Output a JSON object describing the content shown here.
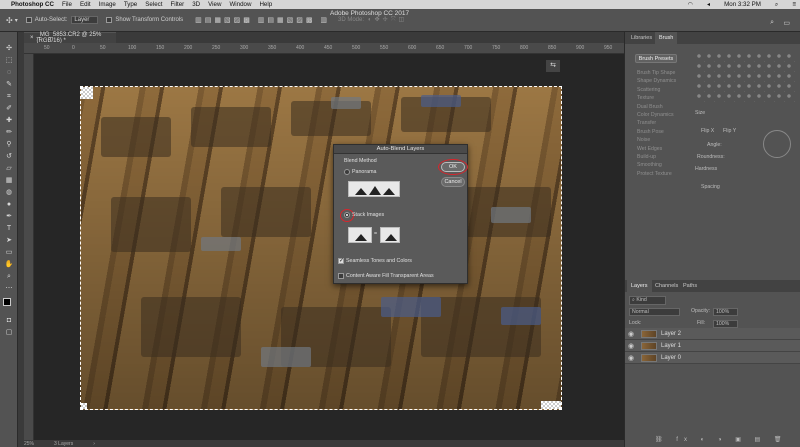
{
  "menubar": {
    "apple": "",
    "app_name": "Photoshop CC",
    "items": [
      "File",
      "Edit",
      "Image",
      "Type",
      "Select",
      "Filter",
      "3D",
      "View",
      "Window",
      "Help"
    ],
    "clock": "Mon 3:32 PM"
  },
  "options_bar": {
    "auto_select_label": "Auto-Select:",
    "auto_select_value": "Layer",
    "transform_controls_label": "Show Transform Controls",
    "mode_3d_label": "3D Mode:",
    "app_title": "Adobe Photoshop CC 2017"
  },
  "document": {
    "tab_label": "_MG_5853.CR2 @ 25% (RGB/16) *",
    "ruler_ticks": [
      "50",
      "0",
      "50",
      "100",
      "150",
      "200",
      "250",
      "300",
      "350",
      "400",
      "450",
      "500",
      "550",
      "600",
      "650",
      "700",
      "750",
      "800",
      "850",
      "900",
      "950"
    ]
  },
  "status_bar": {
    "zoom": "25%",
    "info": "3 Layers"
  },
  "panels": {
    "top_tabs": [
      "Libraries",
      "Brush"
    ],
    "brush_presets_button": "Brush Presets",
    "brush_options": [
      "Brush Tip Shape",
      "Shape Dynamics",
      "Scattering",
      "Texture",
      "Dual Brush",
      "Color Dynamics",
      "Transfer",
      "Brush Pose",
      "Noise",
      "Wet Edges",
      "Build-up",
      "Smoothing",
      "Protect Texture"
    ],
    "brush_labels": {
      "size": "Size",
      "flip_x": "Flip X",
      "flip_y": "Flip Y",
      "angle": "Angle:",
      "roundness": "Roundness:",
      "hardness": "Hardness",
      "spacing": "Spacing"
    },
    "layers_tabs": [
      "Layers",
      "Channels",
      "Paths"
    ],
    "kind_label": "Kind",
    "blend_mode": "Normal",
    "opacity_label": "Opacity:",
    "opacity_value": "100%",
    "lock_label": "Lock:",
    "fill_label": "Fill:",
    "fill_value": "100%",
    "layers": [
      "Layer 2",
      "Layer 1",
      "Layer 0"
    ]
  },
  "dialog": {
    "title": "Auto-Blend Layers",
    "blend_method_label": "Blend Method",
    "panorama_label": "Panorama",
    "stack_images_label": "Stack Images",
    "seamless_label": "Seamless Tones and Colors",
    "content_aware_label": "Content Aware Fill Transparent Areas",
    "ok_label": "OK",
    "cancel_label": "Cancel"
  }
}
